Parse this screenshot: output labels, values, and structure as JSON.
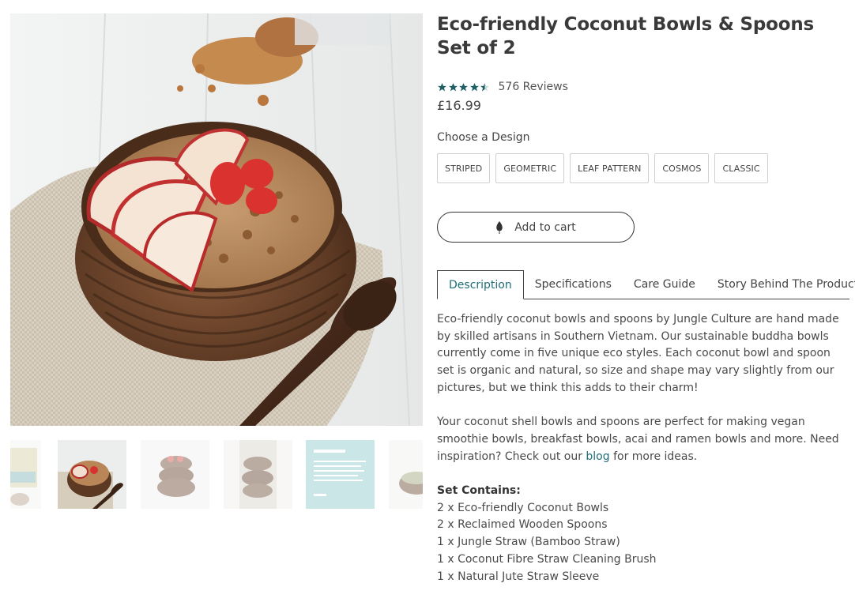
{
  "gallery": {
    "thumbnails": [
      {
        "name": "box-packaging"
      },
      {
        "name": "bowl-with-spoon"
      },
      {
        "name": "stacked-bowls"
      },
      {
        "name": "bowls-held"
      },
      {
        "name": "review-card"
      },
      {
        "name": "bowl-side"
      }
    ],
    "active_index": 1
  },
  "product": {
    "title": "Eco-friendly Coconut Bowls & Spoons Set of 2",
    "rating": 4.5,
    "reviews": "576 Reviews",
    "price": "£16.99",
    "design_label": "Choose a Design",
    "designs": [
      "STRIPED",
      "GEOMETRIC",
      "LEAF PATTERN",
      "COSMOS",
      "CLASSIC"
    ],
    "add_to_cart": "Add to cart",
    "cart_icon": "leaf-icon"
  },
  "tabs": {
    "items": [
      "Description",
      "Specifications",
      "Care Guide",
      "Story Behind The Product"
    ],
    "active": "Description"
  },
  "description": {
    "para1": "Eco-friendly coconut bowls and spoons by Jungle Culture are hand made by skilled artisans in Southern Vietnam. Our sustainable buddha bowls currently come in five unique eco styles. Each coconut bowl and spoon set is organic and natural, so size and shape may vary slightly from our pictures, but we think this adds to their charm!",
    "para2_before": "Your coconut shell bowls and spoons are perfect for making vegan smoothie bowls, breakfast bowls, acai and ramen bowls and more. Need inspiration? Check out our ",
    "para2_link": "blog",
    "para2_after": " for more ideas.",
    "set_title": "Set Contains:",
    "set_items": [
      "2 x Eco-friendly Coconut Bowls",
      "2 x Reclaimed Wooden Spoons",
      "1 x Jungle Straw (Bamboo Straw)",
      "1 x Coconut Fibre Straw Cleaning Brush",
      "1 x Natural Jute Straw Sleeve"
    ]
  },
  "colors": {
    "accent": "#1f6d78",
    "star": "#1f5f66",
    "text": "#444444"
  }
}
